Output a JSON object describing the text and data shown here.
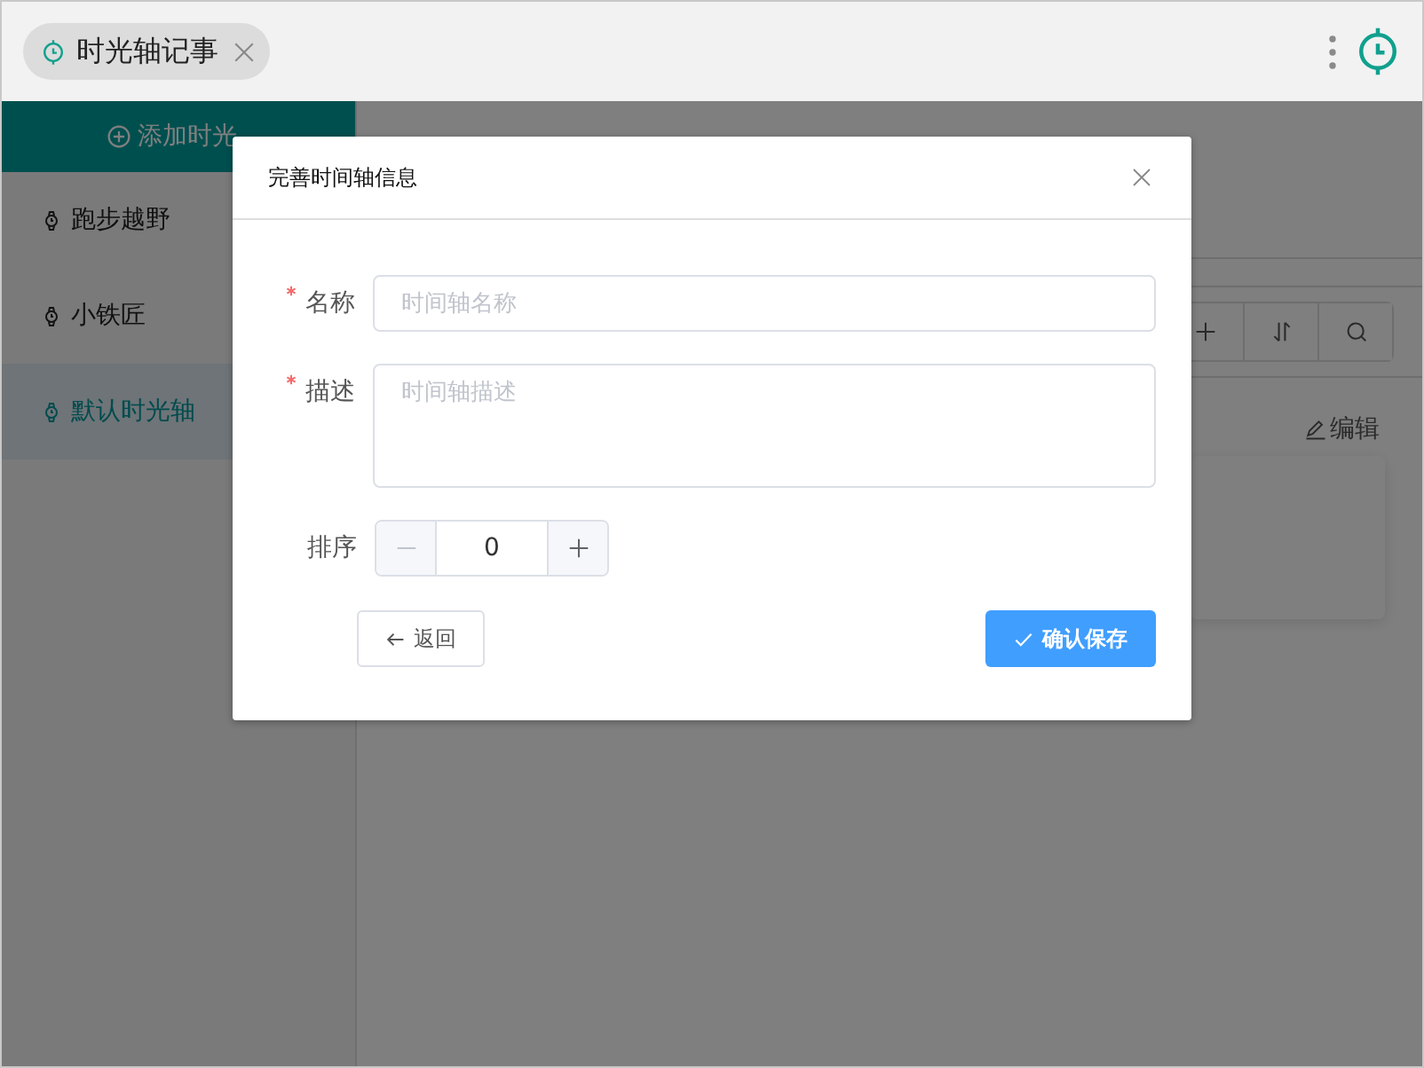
{
  "tab": {
    "label": "时光轴记事"
  },
  "sidebar": {
    "add_button": "添加时光",
    "items": [
      {
        "label": "跑步越野",
        "selected": false
      },
      {
        "label": "小铁匠",
        "selected": false
      },
      {
        "label": "默认时光轴",
        "selected": true
      }
    ]
  },
  "main": {
    "edit_link": "编辑"
  },
  "dialog": {
    "title": "完善时间轴信息",
    "fields": [
      {
        "kind": "input",
        "label": "名称",
        "required": true,
        "placeholder": "时间轴名称"
      },
      {
        "kind": "textarea",
        "label": "描述",
        "required": true,
        "placeholder": "时间轴描述"
      },
      {
        "kind": "stepper",
        "label": "排序",
        "required": false,
        "value": "0"
      }
    ],
    "buttons": [
      {
        "kind": "back",
        "label": "返回"
      },
      {
        "kind": "primary",
        "label": "确认保存"
      }
    ]
  }
}
